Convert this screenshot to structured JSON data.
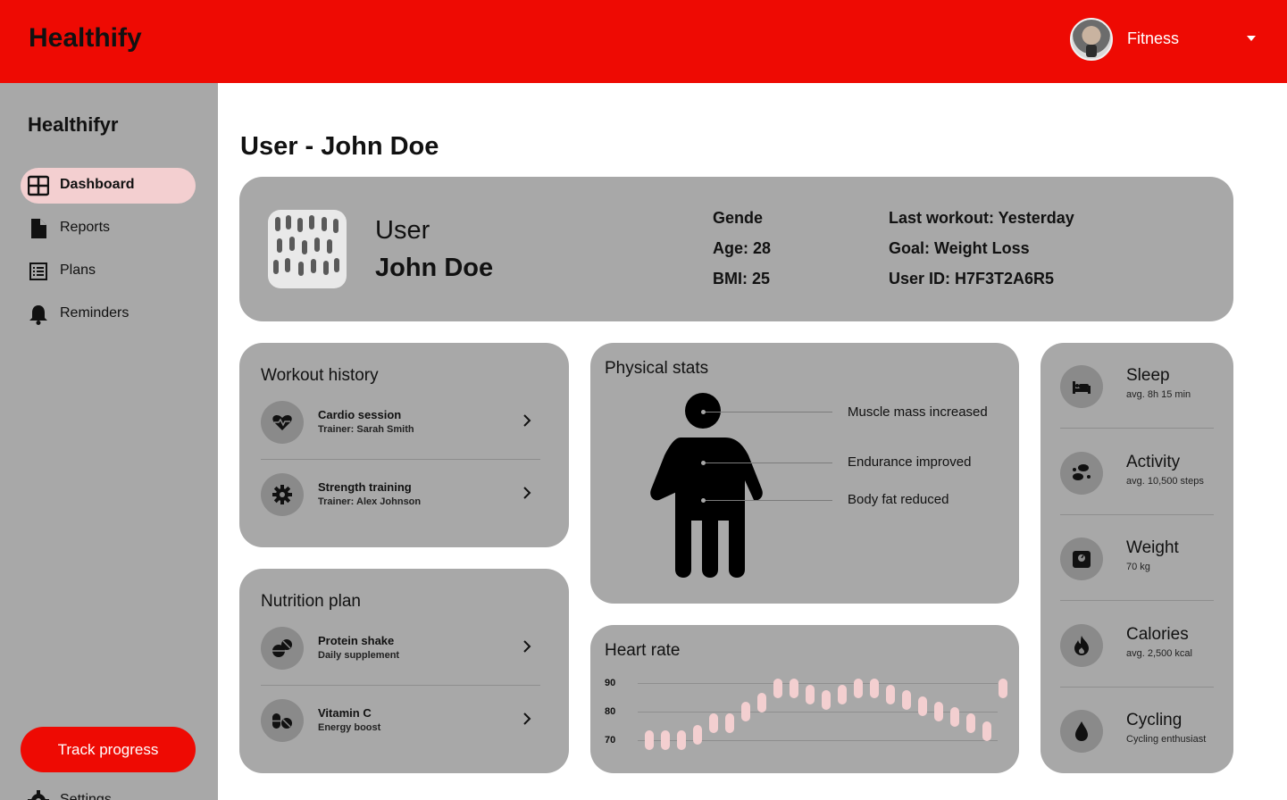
{
  "header": {
    "brand": "Healthify",
    "user_name": "Fitness"
  },
  "sidebar": {
    "title": "Healthifyr",
    "items": [
      {
        "label": "Dashboard",
        "icon": "dashboard-icon",
        "active": true
      },
      {
        "label": "Reports",
        "icon": "document-icon"
      },
      {
        "label": "Plans",
        "icon": "list-icon"
      },
      {
        "label": "Reminders",
        "icon": "bell-icon"
      }
    ],
    "track_button": "Track progress",
    "settings_label": "Settings"
  },
  "page": {
    "title": "User - John Doe"
  },
  "profile": {
    "label": "User",
    "name": "John Doe",
    "gender": "Gende",
    "age": "Age: 28",
    "bmi": "BMI: 25",
    "last_workout": "Last workout: Yesterday",
    "goal": "Goal: Weight Loss",
    "user_id": "User ID: H7F3T2A6R5"
  },
  "workout_history": {
    "title": "Workout history",
    "items": [
      {
        "title": "Cardio session",
        "subtitle": "Trainer: Sarah Smith",
        "icon": "heart-pulse-icon"
      },
      {
        "title": "Strength training",
        "subtitle": "Trainer: Alex Johnson",
        "icon": "gear-icon"
      }
    ]
  },
  "nutrition_plan": {
    "title": "Nutrition plan",
    "items": [
      {
        "title": "Protein shake",
        "subtitle": "Daily supplement",
        "icon": "pills-icon"
      },
      {
        "title": "Vitamin C",
        "subtitle": "Energy boost",
        "icon": "capsule-icon"
      }
    ]
  },
  "physical_stats": {
    "title": "Physical stats",
    "annotations": [
      "Muscle mass increased",
      "Endurance improved",
      "Body fat reduced"
    ]
  },
  "heart_rate": {
    "title": "Heart rate",
    "y_ticks": [
      "90",
      "80",
      "70"
    ],
    "bar_color": "#f3cfd0"
  },
  "chart_data": {
    "type": "bar",
    "title": "Heart rate",
    "y_range": [
      70,
      90
    ],
    "values": [
      70,
      70,
      70,
      72,
      76,
      76,
      80,
      83,
      88,
      88,
      86,
      84,
      86,
      88,
      88,
      86,
      84,
      82,
      80,
      78,
      76,
      73,
      88
    ]
  },
  "metrics": [
    {
      "title": "Sleep",
      "subtitle": "avg. 8h 15 min",
      "icon": "bed-icon"
    },
    {
      "title": "Activity",
      "subtitle": "avg. 10,500 steps",
      "icon": "footsteps-icon"
    },
    {
      "title": "Weight",
      "subtitle": "70 kg",
      "icon": "scale-icon"
    },
    {
      "title": "Calories",
      "subtitle": "avg. 2,500 kcal",
      "icon": "flame-icon"
    },
    {
      "title": "Cycling",
      "subtitle": "Cycling enthusiast",
      "icon": "drop-icon"
    }
  ],
  "colors": {
    "accent": "#ee0a03",
    "panel": "#a8a8a8",
    "highlight": "#f3cfd0"
  }
}
